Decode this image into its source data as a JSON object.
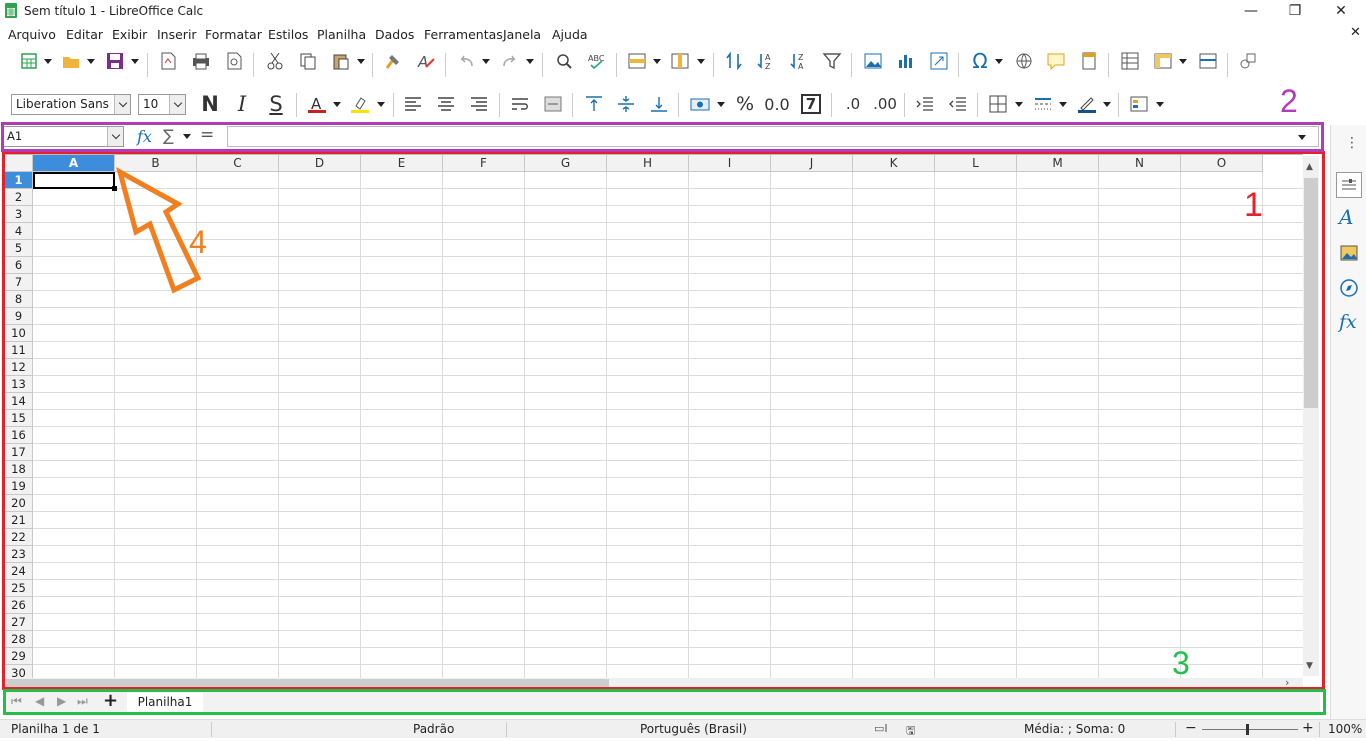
{
  "window": {
    "title": "Sem título 1 - LibreOffice Calc",
    "controls": {
      "minimize": "—",
      "restore": "❐",
      "close": "✕"
    }
  },
  "menubar": [
    "Arquivo",
    "Editar",
    "Exibir",
    "Inserir",
    "Formatar",
    "Estilos",
    "Planilha",
    "Dados",
    "Ferramentas",
    "Janela",
    "Ajuda"
  ],
  "formatting": {
    "font_name": "Liberation Sans",
    "font_size": "10",
    "bold": "N",
    "italic": "I",
    "underline": "S",
    "percent": "%",
    "decimals": "0.0",
    "number": "7",
    "add_decimal": ".0",
    "del_decimal": ".00"
  },
  "formula_bar": {
    "name_box": "A1",
    "fx": "fx",
    "sum": "∑",
    "equals": "=",
    "content": ""
  },
  "grid": {
    "columns": [
      "A",
      "B",
      "C",
      "D",
      "E",
      "F",
      "G",
      "H",
      "I",
      "J",
      "K",
      "L",
      "M",
      "N",
      "O"
    ],
    "rows": [
      "1",
      "2",
      "3",
      "4",
      "5",
      "6",
      "7",
      "8",
      "9",
      "10",
      "11",
      "12",
      "13",
      "14",
      "15",
      "16",
      "17",
      "18",
      "19",
      "20",
      "21",
      "22",
      "23",
      "24",
      "25",
      "26",
      "27",
      "28",
      "29",
      "30"
    ],
    "selected_cell": "A1"
  },
  "sheet_tabs": {
    "add": "+",
    "tabs": [
      "Planilha1"
    ]
  },
  "statusbar": {
    "sheet": "Planilha 1 de 1",
    "style": "Padrão",
    "language": "Português (Brasil)",
    "summary": "Média: ; Soma: 0",
    "zoom": "100%"
  },
  "annotations": {
    "a1": "1",
    "a2": "2",
    "a3": "3",
    "a4": "4",
    "colors": {
      "a1": "#e8202a",
      "a2": "#b03cb8",
      "a3": "#22c04a",
      "a4": "#f07f20"
    }
  },
  "colors": {
    "accent": "#3c8ddb",
    "calc_green": "#2ea44f"
  }
}
